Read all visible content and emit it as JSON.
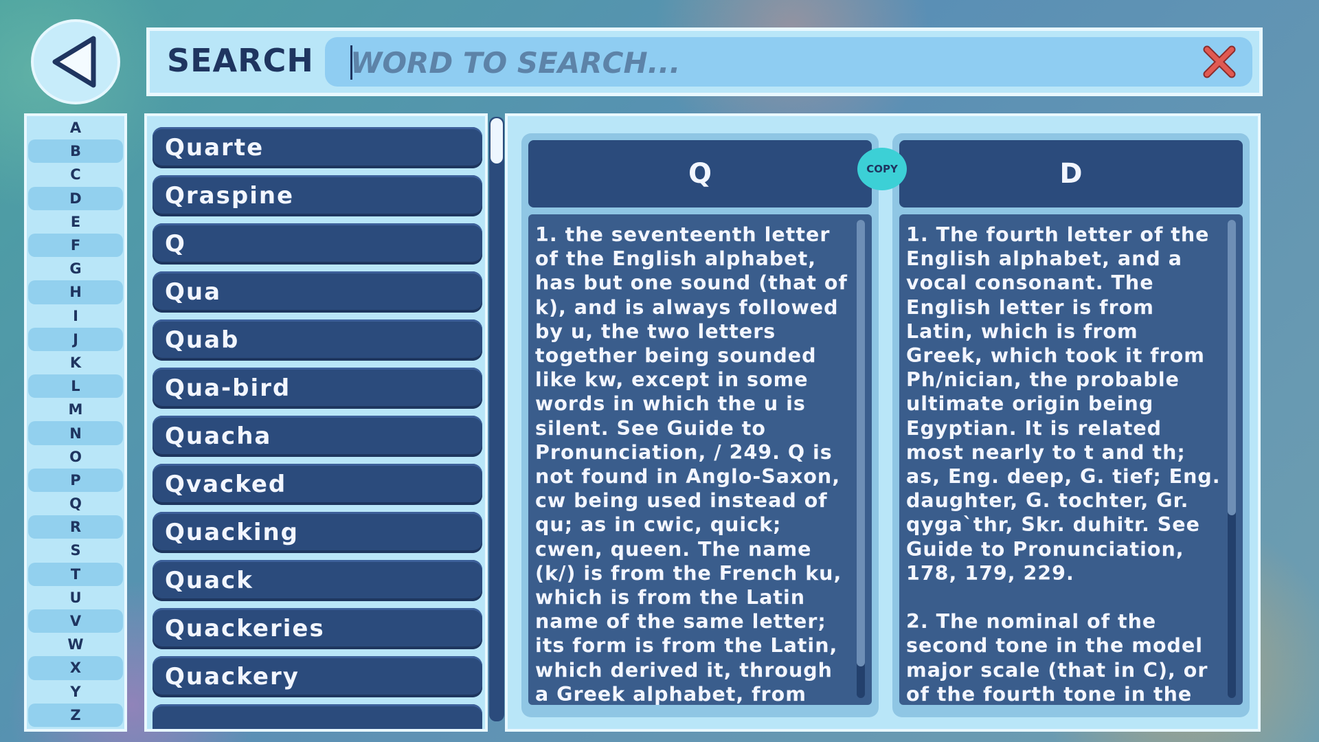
{
  "header": {
    "search_label": "SEARCH",
    "search_placeholder": "WORD TO SEARCH...",
    "search_value": "",
    "icons": {
      "back": "back-arrow-icon",
      "clear": "close-x-icon"
    },
    "colors": {
      "clear_icon": "#d9534f",
      "accent_dark": "#1f3560"
    }
  },
  "alphabet": [
    "A",
    "B",
    "C",
    "D",
    "E",
    "F",
    "G",
    "H",
    "I",
    "J",
    "K",
    "L",
    "M",
    "N",
    "O",
    "P",
    "Q",
    "R",
    "S",
    "T",
    "U",
    "V",
    "W",
    "X",
    "Y",
    "Z"
  ],
  "word_list": [
    "Quarte",
    "Qraspine",
    "Q",
    "Qua",
    "Quab",
    "Qua-bird",
    "Quacha",
    "Qvacked",
    "Quacking",
    "Quack",
    "Quackeries",
    "Quackery"
  ],
  "definition": {
    "copy_label": "COPY",
    "left": {
      "title": "Q",
      "text": "1. the seventeenth letter of the English alphabet, has but one sound (that of k), and is always followed by u, the two letters together being sounded like kw, except in some words in which the u is silent. See Guide to Pronunciation, / 249. Q is not found in Anglo-Saxon, cw being used instead of qu; as in cwic, quick; cwen, queen. The name (k/) is from the French ku, which is from the Latin name of the same letter; its form is from the Latin, which derived it, through a Greek alphabet, from the Ph/nician, the ultimate origin being"
    },
    "right": {
      "title": "D",
      "text": "1. The fourth letter of the English alphabet, and a vocal consonant. The English letter is from Latin, which is from Greek, which took it from Ph/nician, the probable ultimate origin being Egyptian. It is related most nearly to t and th; as, Eng. deep, G. tief; Eng. daughter, G. tochter, Gr. qyga`thr, Skr. duhitr. See Guide to Pronunciation, 178, 179, 229.\n\n2. The nominal of the second tone in the model major scale (that in C), or of the fourth tone in the relative minor scale of C (that in A minor), or of the key tone in"
    }
  }
}
